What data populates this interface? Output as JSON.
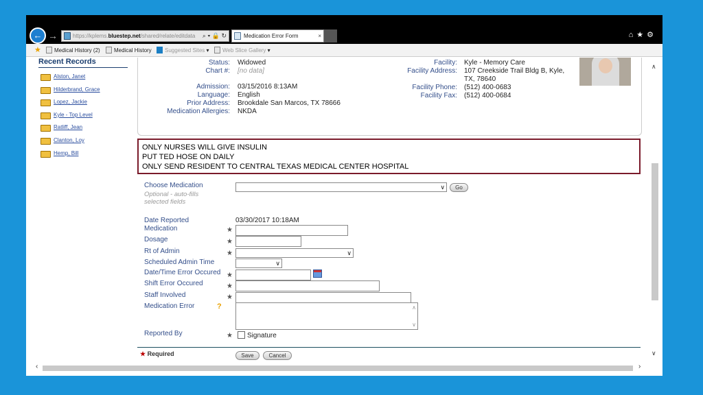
{
  "browser": {
    "url_prefix": "https://",
    "url_host_pre": "kplems.",
    "url_host": "bluestep.net",
    "url_path": "/shared/relate/editdata",
    "addr_controls": "⌕ ▾ 🔒 ↻",
    "tab_title": "Medication Error Form",
    "tab_close": "×",
    "window_controls": "⌂★⚙"
  },
  "favorites": [
    {
      "label": "Medical History (2)",
      "dropdown": ""
    },
    {
      "label": "Medical History",
      "dropdown": ""
    },
    {
      "label": "Suggested Sites",
      "dropdown": "▾"
    },
    {
      "label": "Web Slice Gallery",
      "dropdown": "▾"
    }
  ],
  "sidebar": {
    "title": "Recent Records",
    "items": [
      "Alston, Janet",
      "Hilderbrand, Grace",
      "Lopez, Jackie",
      "Kyle - Top Level",
      "Ratliff, Jean",
      "Clanton, Loy",
      "Hemp, Bill"
    ]
  },
  "resident": {
    "status_label": "Status:",
    "status_value": "Widowed",
    "chart_label": "Chart #:",
    "chart_value": "[no data]",
    "admission_label": "Admission:",
    "admission_value": "03/15/2016 8:13AM",
    "language_label": "Language:",
    "language_value": "English",
    "prior_label": "Prior Address:",
    "prior_value": "Brookdale  San Marcos, TX 78666",
    "allergies_label": "Medication Allergies:",
    "allergies_value": "NKDA",
    "facility_label": "Facility:",
    "facility_value": "Kyle - Memory Care",
    "facility_address_label": "Facility Address:",
    "facility_address_line1": "107 Creekside Trail Bldg B, Kyle,",
    "facility_address_line2": "TX, 78640",
    "facility_phone_label": "Facility Phone:",
    "facility_phone_value": "(512) 400-0683",
    "facility_fax_label": "Facility Fax:",
    "facility_fax_value": "(512) 400-0684"
  },
  "alerts": [
    "ONLY NURSES WILL GIVE INSULIN",
    "PUT TED HOSE ON DAILY",
    "ONLY SEND RESIDENT TO CENTRAL TEXAS MEDICAL CENTER HOSPITAL"
  ],
  "form": {
    "choose_medication_label": "Choose Medication",
    "choose_medication_help": "Optional - auto-fills selected fields",
    "go_button": "Go",
    "date_reported_label": "Date Reported",
    "date_reported_value": "03/30/2017 10:18AM",
    "medication_label": "Medication",
    "dosage_label": "Dosage",
    "rt_admin_label": "Rt of Admin",
    "scheduled_time_label": "Scheduled Admin Time",
    "datetime_error_label": "Date/Time Error Occured",
    "shift_error_label": "Shift Error Occured",
    "staff_involved_label": "Staff Involved",
    "medication_error_label": "Medication Error",
    "help_mark": "?",
    "reported_by_label": "Reported By",
    "signature_label": "Signature",
    "required_star": "★",
    "required_label": "Required",
    "save_button": "Save",
    "cancel_button": "Cancel",
    "caret": "∨"
  },
  "scrollbar": {
    "up": "∧",
    "down": "∨",
    "left": "‹",
    "right": "›"
  }
}
